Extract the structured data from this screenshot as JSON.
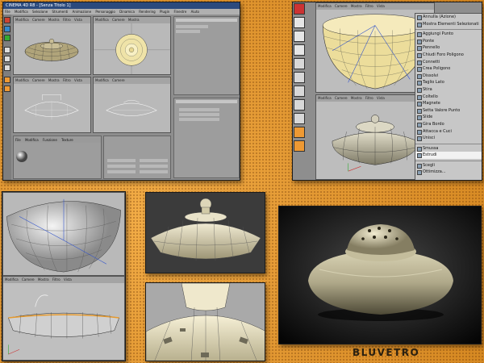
{
  "app": {
    "title": "CINEMA 4D R8 - [Senza Titolo 1]",
    "menu": [
      "File",
      "Modifica",
      "Selezione",
      "Strumenti",
      "Animazione",
      "Personaggio",
      "Dinamica",
      "Rendering",
      "Plugin",
      "Finestre",
      "Aiuto"
    ]
  },
  "viewport_menu": [
    "Modifica",
    "Camere",
    "Mostra",
    "Filtro",
    "Vista"
  ],
  "attr_tabs": [
    "File",
    "Modifica",
    "Funzione",
    "Texture"
  ],
  "context_menu": {
    "items": [
      "Annulla (Azione)",
      "Mostra Elementi Selezionati",
      "Aggiungi Punto",
      "Ponte",
      "Pennello",
      "Chiudi Foro Poligono",
      "Connetti",
      "Crea Poligono",
      "Dissolvi",
      "Taglio Lato",
      "Stira",
      "Coltello",
      "Magnete",
      "Setta Valore Punto",
      "Slide",
      "Gira Bordo",
      "Attacca e Cuci",
      "Unisci"
    ],
    "items_after": [
      "Smussa",
      "Estrudi"
    ],
    "highlighted": "Estrudi",
    "items_bottom": [
      "Scegli",
      "Ottimizza..."
    ]
  },
  "render_title": "BLUVETRO",
  "colors": {
    "title_bar": "#2b4a7d",
    "background_orange": "#e49a34",
    "highlight": "#f2f2f2"
  }
}
